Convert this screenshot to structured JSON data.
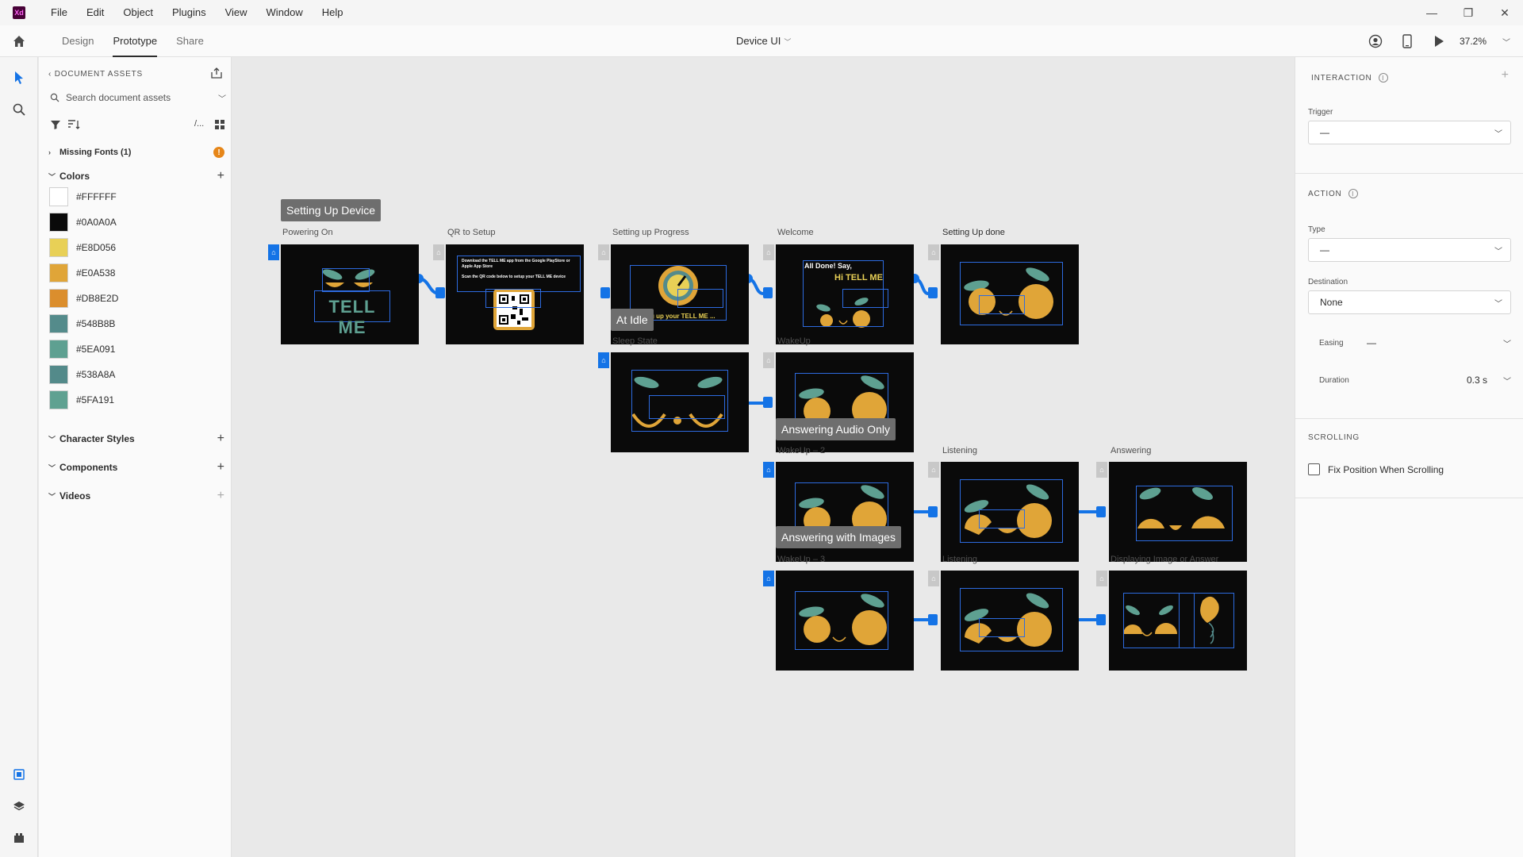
{
  "app": {
    "logo": "Xd"
  },
  "menu": [
    "File",
    "Edit",
    "Object",
    "Plugins",
    "View",
    "Window",
    "Help"
  ],
  "window_controls": {
    "minimize": "—",
    "restore": "❐",
    "close": "✕"
  },
  "tabs": {
    "design": "Design",
    "prototype": "Prototype",
    "share": "Share"
  },
  "document": {
    "title": "Device UI",
    "zoom": "37.2%"
  },
  "assets": {
    "header": "DOCUMENT ASSETS",
    "search_placeholder": "Search document assets",
    "missing_fonts": "Missing Fonts (1)",
    "colors_title": "Colors",
    "colors": [
      {
        "hex": "#FFFFFF",
        "label": "#FFFFFF"
      },
      {
        "hex": "#0A0A0A",
        "label": "#0A0A0A"
      },
      {
        "hex": "#E8D056",
        "label": "#E8D056"
      },
      {
        "hex": "#E0A538",
        "label": "#E0A538"
      },
      {
        "hex": "#DB8E2D",
        "label": "#DB8E2D"
      },
      {
        "hex": "#548B8B",
        "label": "#548B8B"
      },
      {
        "hex": "#5EA091",
        "label": "#5EA091"
      },
      {
        "hex": "#538A8A",
        "label": "#538A8A"
      },
      {
        "hex": "#5FA191",
        "label": "#5FA191"
      }
    ],
    "character_styles": "Character Styles",
    "components": "Components",
    "videos": "Videos",
    "path_label": "/..."
  },
  "canvas": {
    "flows": {
      "setup": "Setting Up Device",
      "idle": "At Idle",
      "audio": "Answering Audio Only",
      "images": "Answering with Images"
    },
    "artboards": {
      "powering_on": "Powering On",
      "qr_setup": "QR to Setup",
      "setup_progress": "Setting up Progress",
      "welcome": "Welcome",
      "setup_done": "Setting Up done",
      "sleep_state": "Sleep State",
      "wakeup": "WakeUp",
      "wakeup_2": "WakeUp – 2",
      "listening": "Listening",
      "answering": "Answering",
      "wakeup_3": "WakeUp – 3",
      "listening_2": "Listening",
      "displaying": "Displaying Image or Answer"
    },
    "art_text": {
      "tell_me": "TELL ME",
      "all_done": "All Done! Say,",
      "hi_tell_me": "Hi TELL ME",
      "setting_up": "g up your TELL ME ...",
      "qr_line1": "Download the TELL ME app from the Google PlayStore or Apple App Store",
      "qr_line2": "Scan the QR code below to setup your TELL ME device"
    }
  },
  "properties": {
    "interaction_title": "INTERACTION",
    "trigger_label": "Trigger",
    "trigger_value": "—",
    "action_title": "ACTION",
    "type_label": "Type",
    "type_value": "—",
    "destination_label": "Destination",
    "destination_value": "None",
    "easing_label": "Easing",
    "easing_value": "—",
    "duration_label": "Duration",
    "duration_value": "0.3 s",
    "scrolling_title": "SCROLLING",
    "fix_position_label": "Fix Position When Scrolling"
  }
}
